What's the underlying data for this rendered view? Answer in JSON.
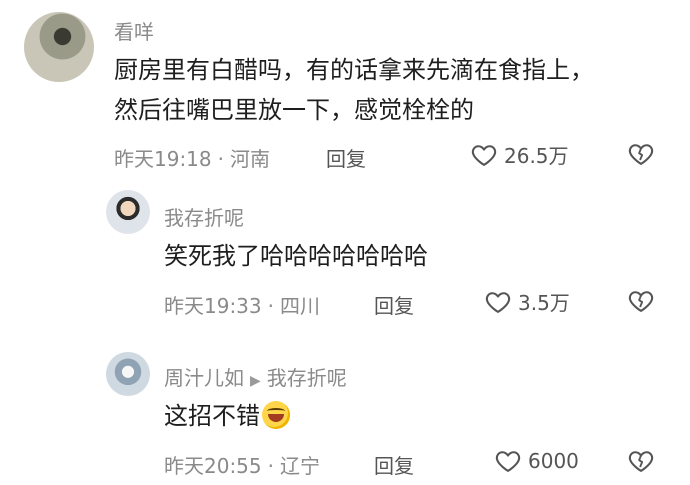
{
  "comment": {
    "user": "看咩",
    "lines": [
      "厨房里有白醋吗，有的话拿来先滴在食指上，",
      "然后往嘴巴里放一下，感觉栓栓的"
    ],
    "time": "昨天19:18",
    "location": "河南",
    "reply_label": "回复",
    "likes": "26.5万"
  },
  "replies": [
    {
      "user": "我存折呢",
      "text": "笑死我了哈哈哈哈哈哈哈",
      "time": "昨天19:33",
      "location": "四川",
      "reply_label": "回复",
      "likes": "3.5万"
    },
    {
      "user": "周汁儿如",
      "reply_to": "我存折呢",
      "text": "这招不错",
      "time": "昨天20:55",
      "location": "辽宁",
      "reply_label": "回复",
      "likes": "6000"
    }
  ],
  "icons": [
    "heart-outline-icon",
    "broken-heart-icon",
    "laughing-emoji-icon",
    "reply-arrow-icon"
  ]
}
